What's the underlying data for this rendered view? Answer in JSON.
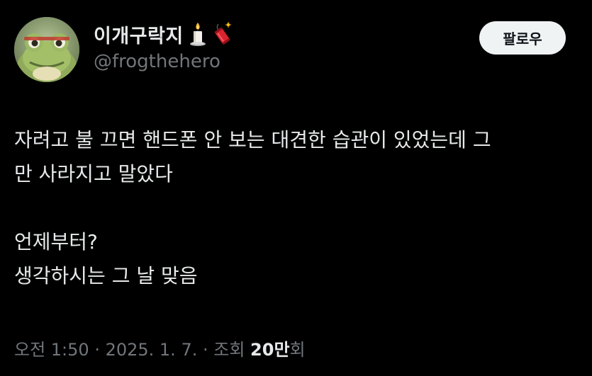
{
  "author": {
    "display_name": "이개구락지",
    "handle": "@frogthehero",
    "name_emojis": [
      "candle-icon",
      "firecracker-icon"
    ]
  },
  "follow_button": {
    "label": "팔로우"
  },
  "tweet": {
    "paragraphs": [
      {
        "lines": [
          "자려고 불 끄면 핸드폰 안 보는 대견한 습관이 있었는데 그",
          "만 사라지고 말았다"
        ]
      },
      {
        "lines": [
          "언제부터?",
          "생각하시는 그 날 맞음"
        ]
      }
    ]
  },
  "meta": {
    "time": "오전 1:50",
    "separator": " · ",
    "date": "2025. 1. 7.",
    "views_label": "조회",
    "views_count": "20만",
    "views_suffix": "회"
  },
  "colors": {
    "background": "#000000",
    "text_primary": "#e7e9ea",
    "text_secondary": "#71767b",
    "button_bg": "#eff3f4",
    "button_text": "#0f1419"
  }
}
